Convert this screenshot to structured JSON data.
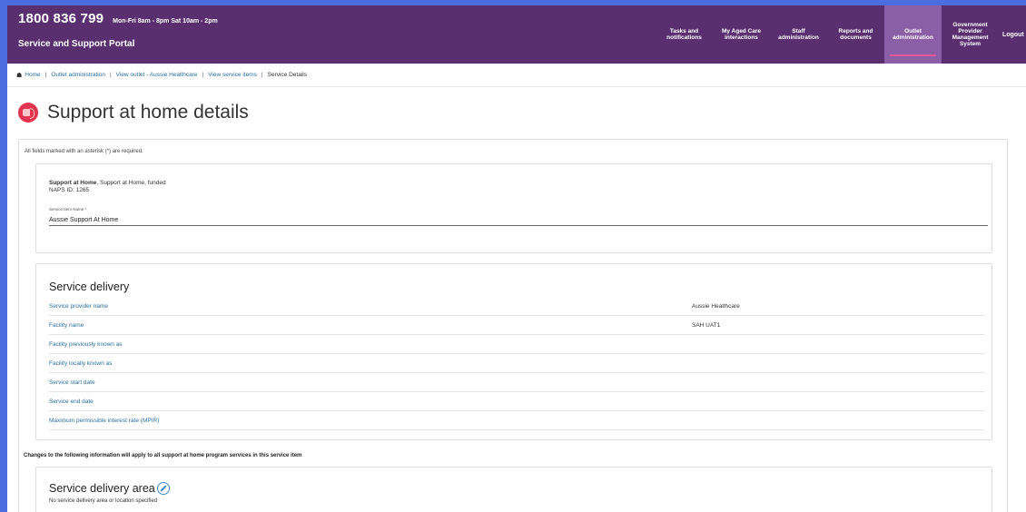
{
  "header": {
    "phone": "1800 836 799",
    "hours": "Mon-Fri 8am - 8pm Sat 10am - 2pm",
    "portal_title": "Service and Support Portal",
    "nav": [
      {
        "label": "Tasks and notifications"
      },
      {
        "label": "My Aged Care interactions"
      },
      {
        "label": "Staff administration"
      },
      {
        "label": "Reports and documents"
      },
      {
        "label": "Outlet administration",
        "active": true
      },
      {
        "label": "Government Provider Management System"
      },
      {
        "label": "Logout"
      }
    ]
  },
  "breadcrumb": {
    "items": [
      "Home",
      "Outlet administration",
      "View outlet - Aussie Healthcare",
      "View service items"
    ],
    "current": "Service Details"
  },
  "page": {
    "title": "Support at home details",
    "required_note": "All fields marked with an asterisk (*) are required."
  },
  "service_item": {
    "type_bold": "Support at Home",
    "type_rest": ", Support at Home, funded",
    "napsid": "NAPS ID: 1265",
    "name_label": "Service Item Name *",
    "name_value": "Aussie Support At Home"
  },
  "service_delivery": {
    "heading": "Service delivery",
    "rows": [
      {
        "key": "Service provider name",
        "value": "Aussie Healthcare"
      },
      {
        "key": "Facility name",
        "value": "SAH UAT1"
      },
      {
        "key": "Facility previously known as",
        "value": ""
      },
      {
        "key": "Facility locally known as",
        "value": ""
      },
      {
        "key": "Service start date",
        "value": ""
      },
      {
        "key": "Service end date",
        "value": ""
      },
      {
        "key": "Maximum permissible interest rate (MPIR)",
        "value": ""
      }
    ]
  },
  "changes_note": "Changes to the following information will apply to all support at home program services in this service item",
  "delivery_area": {
    "heading": "Service delivery area",
    "note": "No service delivery area or location specified"
  },
  "colors": {
    "header_bg": "#5a2f6f",
    "active_tab": "#8a5fa6",
    "accent_pink": "#e4579a",
    "link": "#2a6f9a",
    "title_icon": "#e2344e",
    "outer_border": "#4a6ee0"
  }
}
